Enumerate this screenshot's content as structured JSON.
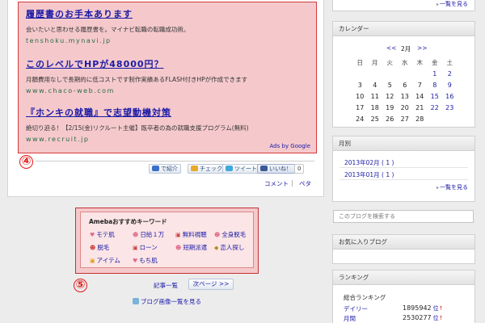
{
  "ads": {
    "items": [
      {
        "title": "履歴書のお手本あります",
        "desc": "会いたいと思わせる履歴書を。マイナビ転職の転職成功術。",
        "url": "tenshoku.mynavi.jp"
      },
      {
        "title": "このレベルでHPが48000円？",
        "desc": "月額費用なしで長期的に低コストです制作実績あるFLASH付きHPが作成できます",
        "url": "www.chaco-web.com"
      },
      {
        "title": "『ホンキの就職』で志望動機対策",
        "desc": "絶切り迫る！【2/15(金)リクルート主催】既卒者の為の就職支援プログラム(無料)",
        "url": "www.recruit.jp"
      }
    ],
    "ads_by": "Ads by Google"
  },
  "markers": {
    "four": "④",
    "five": "⑤"
  },
  "share": {
    "intro": "で紹介",
    "check": "チェック",
    "tweet": "ツイート",
    "like": "いいね！",
    "like_count": "0"
  },
  "post_footer": {
    "comment": "コメント",
    "sep": "|",
    "pe": "ペタ"
  },
  "keywords": {
    "title": "Amebaおすすめキーワード",
    "items": [
      {
        "label": "モテ肌"
      },
      {
        "label": "日給１万"
      },
      {
        "label": "無料視聴"
      },
      {
        "label": "全身脱毛"
      },
      {
        "label": "脱毛"
      },
      {
        "label": "ローン"
      },
      {
        "label": "短期派遣"
      },
      {
        "label": "恋人探し"
      },
      {
        "label": "アイテム"
      },
      {
        "label": "もち肌"
      }
    ]
  },
  "nav": {
    "article_list": "記事一覧",
    "next_page": "次ページ >>",
    "image_list": "ブログ画像一覧を見る"
  },
  "sidebar": {
    "top_see_all": "一覧を見る",
    "calendar": {
      "title": "カレンダー",
      "prev": "<<",
      "month": "2月",
      "next": ">>",
      "weekdays": [
        "日",
        "月",
        "火",
        "水",
        "木",
        "金",
        "土"
      ],
      "weeks": [
        [
          "",
          "",
          "",
          "",
          "",
          "1",
          "2"
        ],
        [
          "3",
          "4",
          "5",
          "6",
          "7",
          "8",
          "9"
        ],
        [
          "10",
          "11",
          "12",
          "13",
          "14",
          "15",
          "16"
        ],
        [
          "17",
          "18",
          "19",
          "20",
          "21",
          "22",
          "23"
        ],
        [
          "24",
          "25",
          "26",
          "27",
          "28",
          "",
          ""
        ]
      ],
      "linked_days": [
        "1",
        "2",
        "8",
        "9",
        "15",
        "16",
        "22",
        "23"
      ]
    },
    "monthly": {
      "title": "月別",
      "items": [
        "2013年02月 ( 1 )",
        "2013年01月 ( 1 )"
      ],
      "see_all": "一覧を見る"
    },
    "search_placeholder": "このブログを検索する",
    "favorites": {
      "title": "お気に入りブログ"
    },
    "ranking": {
      "title": "ランキング",
      "overall": "総合ランキング",
      "rows": [
        {
          "label": "デイリー",
          "value": "1895942",
          "unit": "位",
          "trend": "↑"
        },
        {
          "label": "月間",
          "value": "2530277",
          "unit": "位",
          "trend": "↑"
        }
      ]
    }
  }
}
